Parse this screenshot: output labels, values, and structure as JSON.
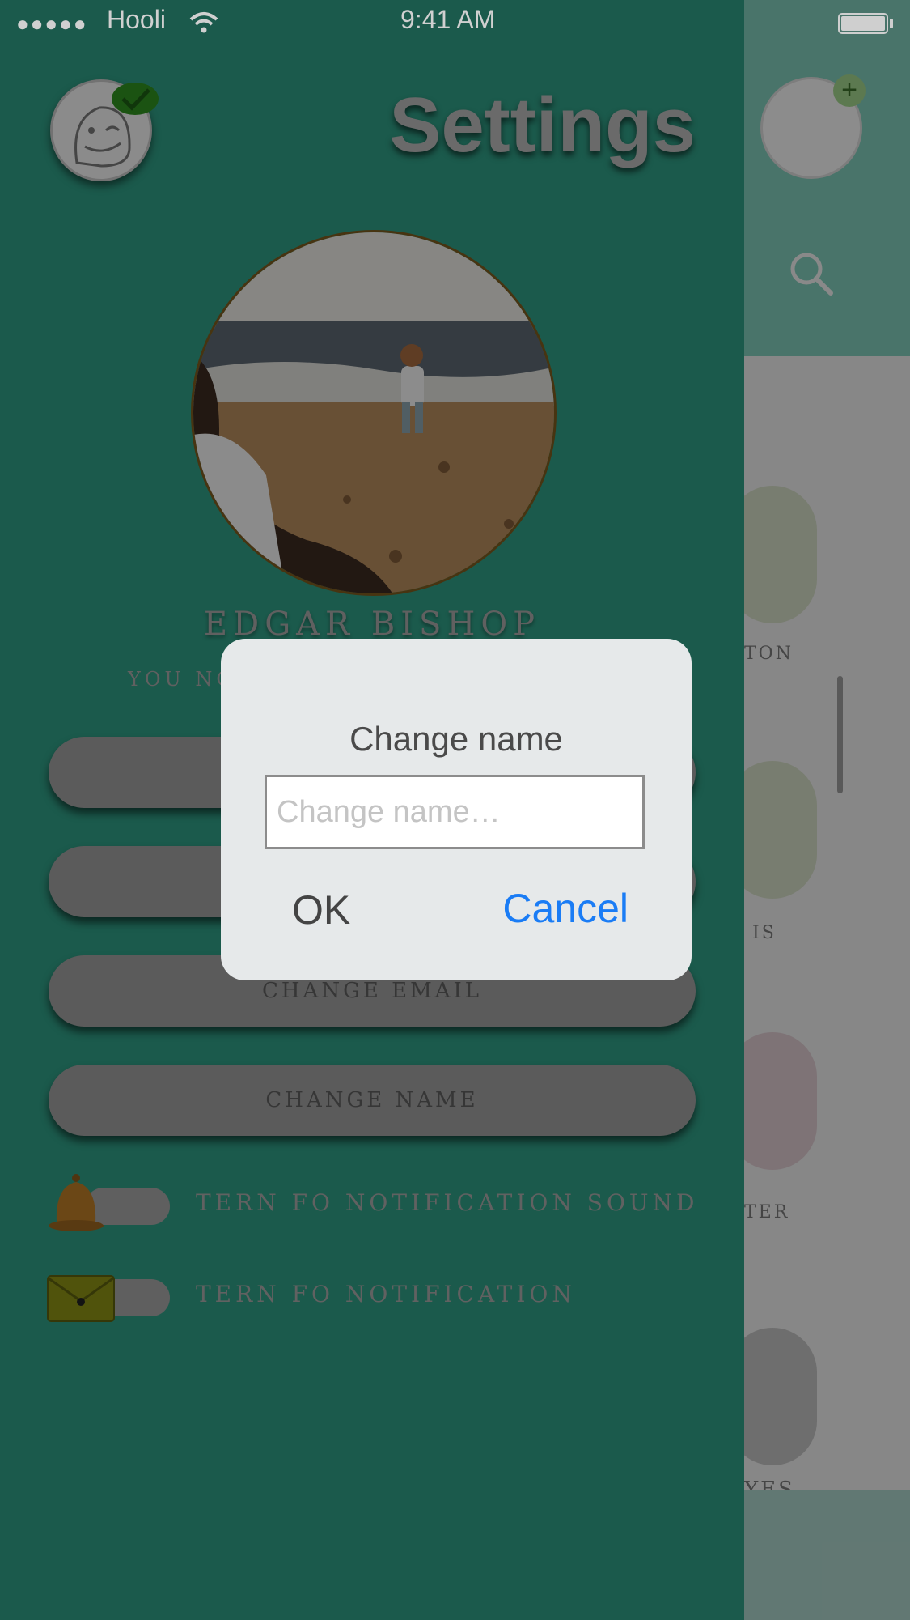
{
  "status_bar": {
    "signal": "●●●●●",
    "carrier": "Hooli",
    "time": "9:41 AM"
  },
  "drawer": {
    "title": "Settings",
    "user_name": "EDGAR BISHOP",
    "subtitle": "YOU NO",
    "buttons": [
      {
        "label": ""
      },
      {
        "label": ""
      },
      {
        "label": "CHANGE EMAIL"
      },
      {
        "label": "CHANGE NAME"
      }
    ],
    "toggles": [
      {
        "label": "TERN FO NOTIFICATION SOUND",
        "icon": "bell-icon"
      },
      {
        "label": "TERN FO NOTIFICATION",
        "icon": "envelope-icon"
      }
    ]
  },
  "background_list": {
    "labels": [
      "TON",
      "IS",
      "TER",
      "YES"
    ]
  },
  "dialog": {
    "title": "Change name",
    "input_value": "",
    "input_placeholder": "Change name…",
    "ok_label": "OK",
    "cancel_label": "Cancel"
  },
  "colors": {
    "drawer": "#2f9b83",
    "dialog": "#e6e9ea",
    "cancel": "#1a7cf5"
  }
}
